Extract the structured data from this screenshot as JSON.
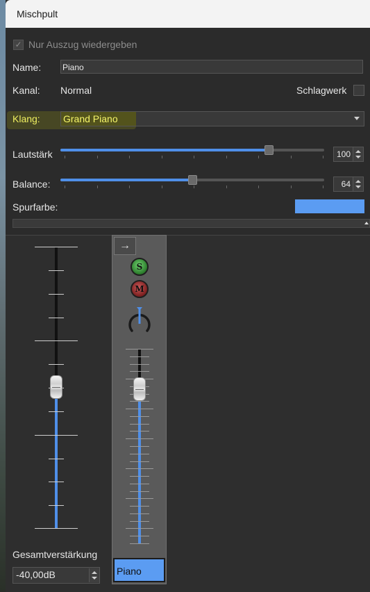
{
  "window": {
    "title": "Mischpult"
  },
  "instrument": {
    "nur_auszug_label": "Nur Auszug wiedergeben",
    "nur_auszug_checked": true,
    "name_label": "Name:",
    "name_value": "Piano",
    "kanal_label": "Kanal:",
    "kanal_value": "Normal",
    "schlagwerk_label": "Schlagwerk",
    "schlagwerk_checked": false,
    "klang_label": "Klang:",
    "klang_value": "Grand Piano",
    "lautstaerke_label": "Lautstärk",
    "lautstaerke_value": "100",
    "lautstaerke_fraction": 0.79,
    "balance_label": "Balance:",
    "balance_value": "64",
    "balance_fraction": 0.5,
    "spurfarbe_label": "Spurfarbe:",
    "spurfarbe_color": "#5b9cf2"
  },
  "mixer": {
    "route_icon": "arrow-right-icon",
    "solo_label": "S",
    "mute_label": "M",
    "channel_name": "Piano",
    "master_label": "Gesamtverstärkung",
    "master_value": "-40,00dB"
  },
  "colors": {
    "accent": "#4f8fe8",
    "highlight": "#f0f060",
    "solo": "#3a9a3a",
    "mute": "#9a2a2a"
  }
}
